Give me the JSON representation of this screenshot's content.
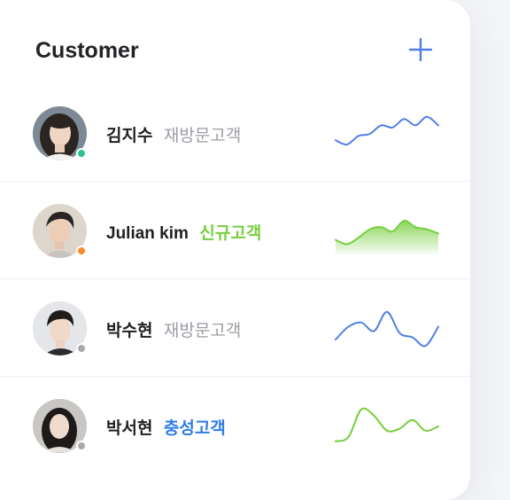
{
  "header": {
    "title": "Customer",
    "add_icon": "plus-icon"
  },
  "colors": {
    "blue": "#4f7fe6",
    "green": "#76cf3e",
    "gray_tag": "#9a9da3",
    "dot_green": "#2fc28e",
    "dot_orange": "#ff8a2a",
    "dot_gray": "#a8aaae"
  },
  "customers": [
    {
      "name": "김지수",
      "tag": "재방문고객",
      "tag_color": "#9a9da3",
      "status_color": "#2fc28e",
      "trend_color": "#4f7fe6",
      "trend_filled": false,
      "trend": [
        0.35,
        0.25,
        0.45,
        0.5,
        0.7,
        0.65,
        0.85,
        0.7,
        0.9,
        0.7
      ]
    },
    {
      "name": "Julian kim",
      "tag": "신규고객",
      "tag_color": "#76cf3e",
      "status_color": "#ff8a2a",
      "trend_color": "#76cf3e",
      "trend_filled": true,
      "trend": [
        0.3,
        0.2,
        0.35,
        0.55,
        0.6,
        0.5,
        0.75,
        0.6,
        0.55,
        0.45
      ]
    },
    {
      "name": "박수현",
      "tag": "재방문고객",
      "tag_color": "#9a9da3",
      "status_color": "#a8aaae",
      "trend_color": "#4f7fe6",
      "trend_filled": false,
      "trend": [
        0.25,
        0.55,
        0.65,
        0.45,
        0.9,
        0.4,
        0.3,
        0.1,
        0.55
      ]
    },
    {
      "name": "박서현",
      "tag": "충성고객",
      "tag_color": "#2f7ce6",
      "status_color": "#a8aaae",
      "trend_color": "#76cf3e",
      "trend_filled": false,
      "trend": [
        0.15,
        0.25,
        0.9,
        0.75,
        0.4,
        0.45,
        0.65,
        0.4,
        0.5
      ]
    }
  ]
}
